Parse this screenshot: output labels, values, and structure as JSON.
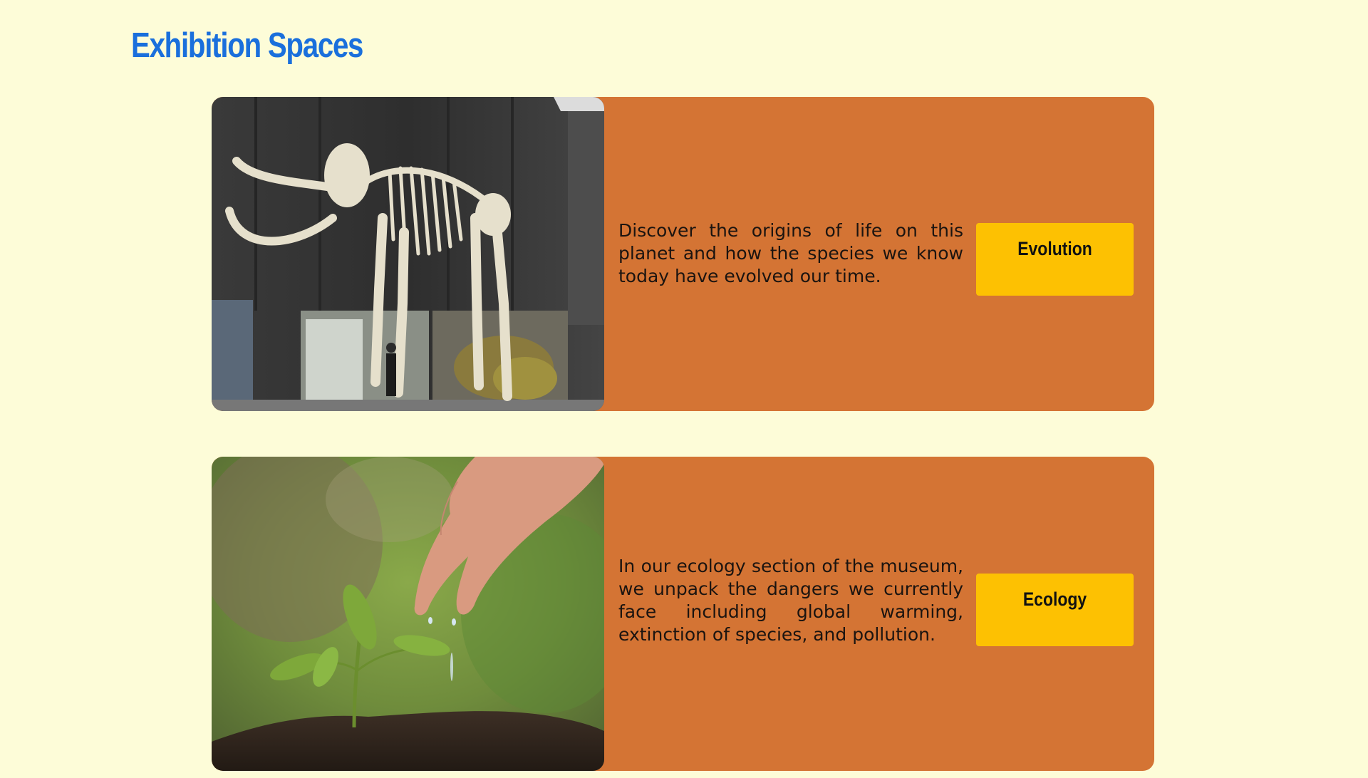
{
  "colors": {
    "background": "#fdfcd8",
    "title": "#1a6fdc",
    "card": "#d47434",
    "button": "#fdc102"
  },
  "page": {
    "title": "Exhibition Spaces"
  },
  "exhibits": [
    {
      "image_icon": "mammoth-skeleton-photo",
      "description": "Discover the origins of life on this planet and how the species we know today have evolved our time.",
      "button_label": "Evolution"
    },
    {
      "image_icon": "watering-seedling-photo",
      "description": "In our ecology section of the museum, we unpack the dangers we currently face including global warming, extinction of species, and pollution.",
      "button_label": "Ecology"
    }
  ]
}
